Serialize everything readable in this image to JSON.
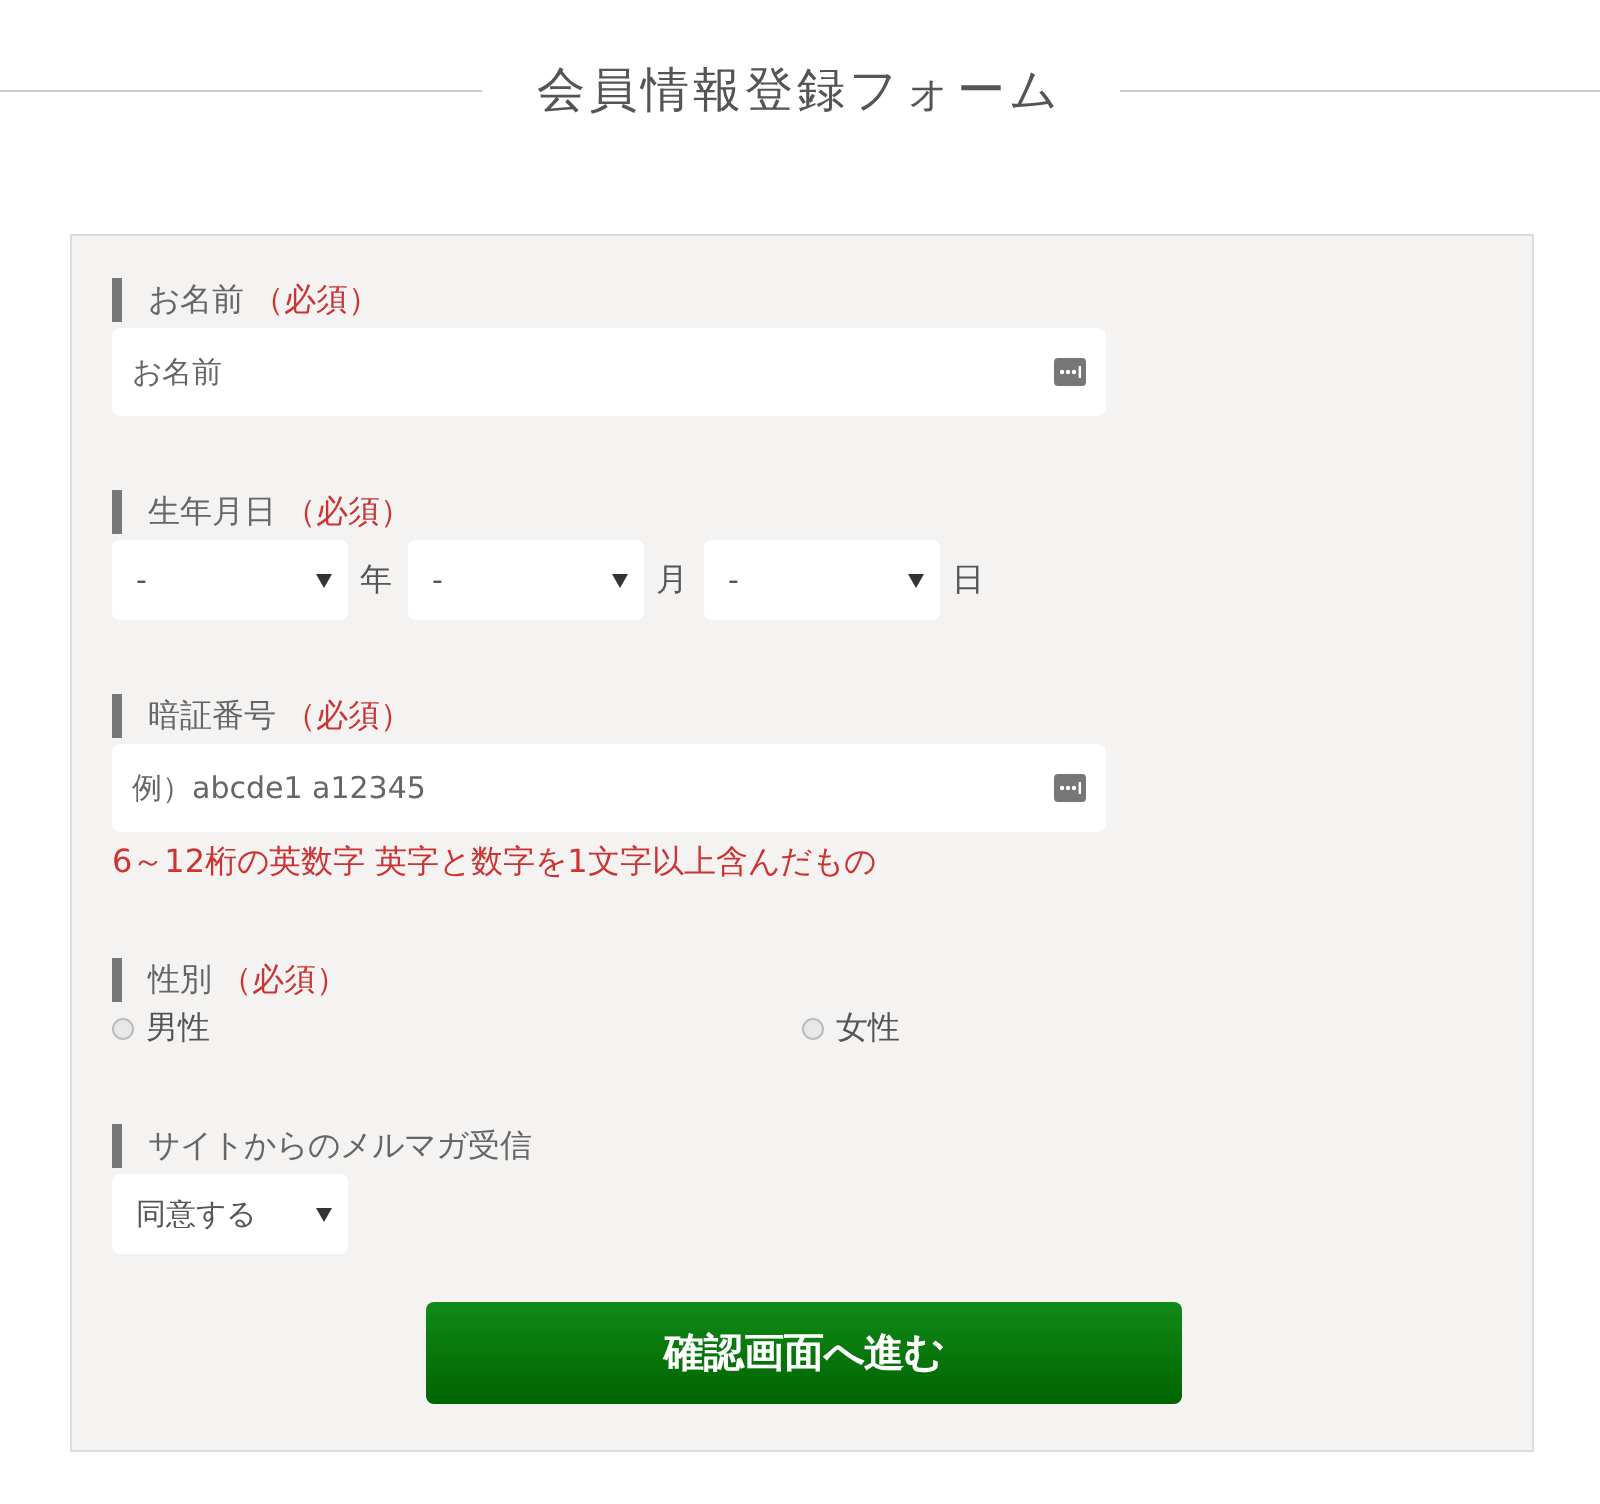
{
  "title": "会員情報登録フォーム",
  "fields": [
    {
      "kind": "text",
      "label": "お名前",
      "required": "（必須）",
      "placeholder": "お名前"
    },
    {
      "kind": "date",
      "label": "生年月日",
      "required": "（必須）",
      "selects": [
        {
          "value": "-",
          "unit": "年"
        },
        {
          "value": "-",
          "unit": "月"
        },
        {
          "value": "-",
          "unit": "日"
        }
      ]
    },
    {
      "kind": "text",
      "label": "暗証番号",
      "required": "（必須）",
      "placeholder": "例）abcde1 a12345",
      "note": "6～12桁の英数字 英字と数字を1文字以上含んだもの"
    },
    {
      "kind": "radio",
      "label": "性別",
      "required": "（必須）",
      "options": [
        {
          "label": "男性",
          "selected": false
        },
        {
          "label": "女性",
          "selected": false
        }
      ]
    },
    {
      "kind": "select",
      "label": "サイトからのメルマガ受信",
      "value": "同意する"
    }
  ],
  "submit": "確認画面へ進む"
}
